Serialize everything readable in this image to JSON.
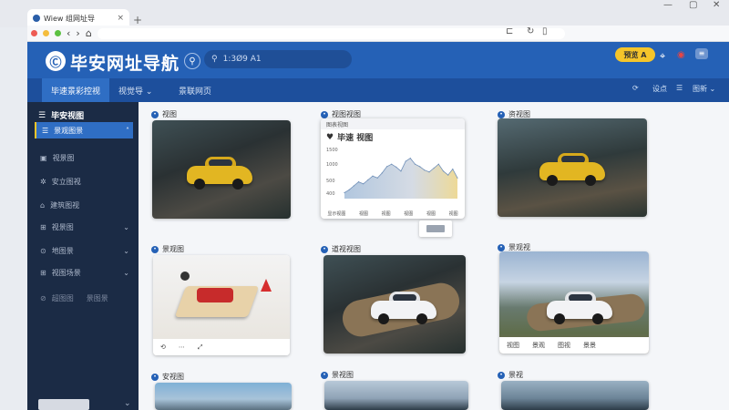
{
  "browser": {
    "tab_title": "Wiew 组网址导",
    "close": "×",
    "new_tab": "+",
    "back": "‹",
    "forward": "›",
    "reload": "↻",
    "home": "⌂"
  },
  "header": {
    "logo_text": "毕安网址导航",
    "search_placeholder": "1:3Ø9 A1",
    "yellow_button_label": "预览 A"
  },
  "nav": {
    "tabs": [
      {
        "label": "毕速景彩控视"
      },
      {
        "label": "视觉导 ⌄"
      },
      {
        "label": "景联网页"
      }
    ],
    "right_items": [
      {
        "label": "⟳"
      },
      {
        "label": "设点"
      },
      {
        "label": "☰"
      },
      {
        "label": "图新 ⌄"
      }
    ]
  },
  "sidebar": {
    "title": "毕安视图",
    "items": [
      {
        "label": "景观图景",
        "chevron": "˄"
      },
      {
        "label": "视景图"
      },
      {
        "label": "安立图视"
      },
      {
        "label": "建筑图视"
      },
      {
        "label": "视景图",
        "chevron": "⌄"
      },
      {
        "label": "地图景",
        "chevron": "⌄"
      },
      {
        "label": "视图场景",
        "chevron": "⌄"
      },
      {
        "label": "超图图",
        "extra": "景图景"
      }
    ],
    "bottom_chevron": "⌄"
  },
  "cards": [
    {
      "label": "视图"
    },
    {
      "label": "视图视图"
    },
    {
      "label": "资视图"
    },
    {
      "label": "景观图"
    },
    {
      "label": "道视视图"
    },
    {
      "label": "景观视"
    },
    {
      "label": "安视图"
    },
    {
      "label": "景视图"
    },
    {
      "label": "景视"
    }
  ],
  "card_footers": {
    "card3": [
      "⟲",
      "⋯",
      "⤢"
    ],
    "card5": [
      "视图",
      "景观",
      "图视",
      "景景"
    ]
  },
  "chart_card": {
    "top_bar": "图表视图",
    "title": "毕速 视图",
    "footer": [
      "显示视图",
      "视图",
      "视图",
      "视图",
      "视图",
      "视图"
    ]
  },
  "chart_data": {
    "type": "area",
    "title": "毕速 视图",
    "y_ticks": [
      "1500",
      "1000",
      "500",
      "400"
    ],
    "x": [
      0,
      1,
      2,
      3,
      4,
      5,
      6,
      7,
      8,
      9,
      10,
      11,
      12,
      13,
      14,
      15,
      16,
      17,
      18,
      19,
      20,
      21,
      22,
      23,
      24
    ],
    "values": [
      120,
      180,
      260,
      340,
      300,
      380,
      460,
      420,
      520,
      650,
      700,
      640,
      560,
      760,
      820,
      700,
      650,
      580,
      540,
      620,
      700,
      560,
      480,
      600,
      420
    ],
    "ylim": [
      0,
      1000
    ],
    "grid": false
  },
  "colors": {
    "header_blue": "#2561b6",
    "sidebar_dark": "#1b2b45",
    "accent_yellow": "#f5c52a",
    "active_nav": "#2f6ec4"
  }
}
